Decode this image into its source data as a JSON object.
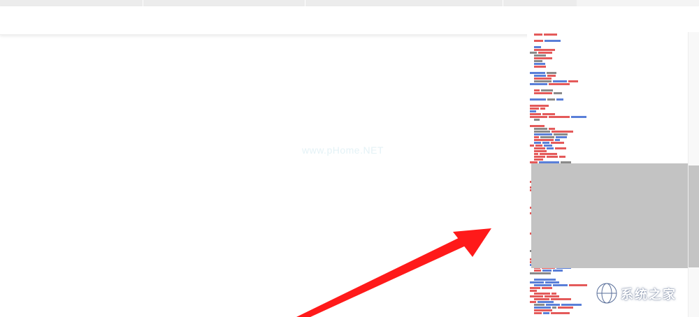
{
  "watermark": {
    "text": "www.pHome.NET"
  },
  "logo": {
    "text": "系统之家",
    "icon": "globe-icon"
  },
  "colors": {
    "arrow": "#ff1a1a",
    "code_red": "#e45a5a",
    "code_blue": "#5a7fd8",
    "selection": "#c3c3c3"
  }
}
